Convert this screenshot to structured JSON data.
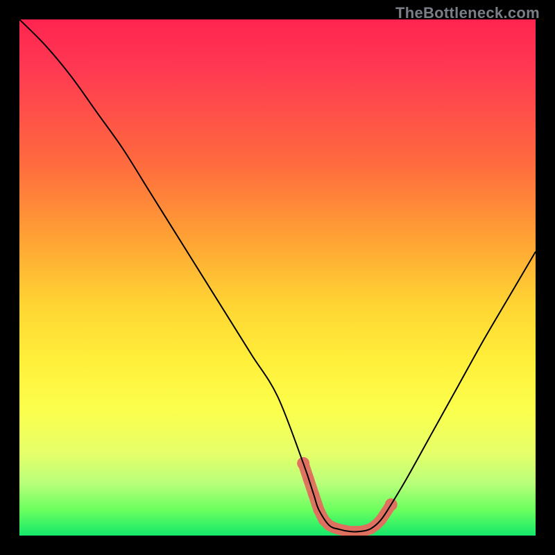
{
  "watermark": "TheBottleneck.com",
  "chart_data": {
    "type": "line",
    "title": "",
    "xlabel": "",
    "ylabel": "",
    "xlim": [
      0,
      100
    ],
    "ylim": [
      0,
      100
    ],
    "series": [
      {
        "name": "bottleneck-curve",
        "x": [
          0,
          5,
          10,
          15,
          20,
          25,
          30,
          35,
          40,
          45,
          50,
          55,
          57,
          58,
          60,
          62,
          64,
          66,
          68,
          70,
          72,
          75,
          80,
          85,
          90,
          95,
          100
        ],
        "values": [
          100,
          95,
          89,
          82,
          75,
          67,
          59,
          51,
          43,
          35,
          27,
          14,
          8,
          5,
          2,
          1.2,
          0.8,
          0.8,
          1.3,
          3,
          6,
          11,
          20,
          29,
          38,
          46.5,
          55
        ]
      },
      {
        "name": "highlight-band",
        "x": [
          55,
          56,
          57,
          58,
          59,
          60,
          61,
          62,
          63,
          64,
          65,
          66,
          67,
          68,
          69,
          70,
          71,
          72
        ],
        "values": [
          14,
          11,
          8,
          5,
          3,
          2,
          1.5,
          1.2,
          1.0,
          0.8,
          0.8,
          0.8,
          1.0,
          1.3,
          2,
          3,
          4.5,
          6
        ]
      }
    ],
    "highlight_color": "#e07060"
  }
}
